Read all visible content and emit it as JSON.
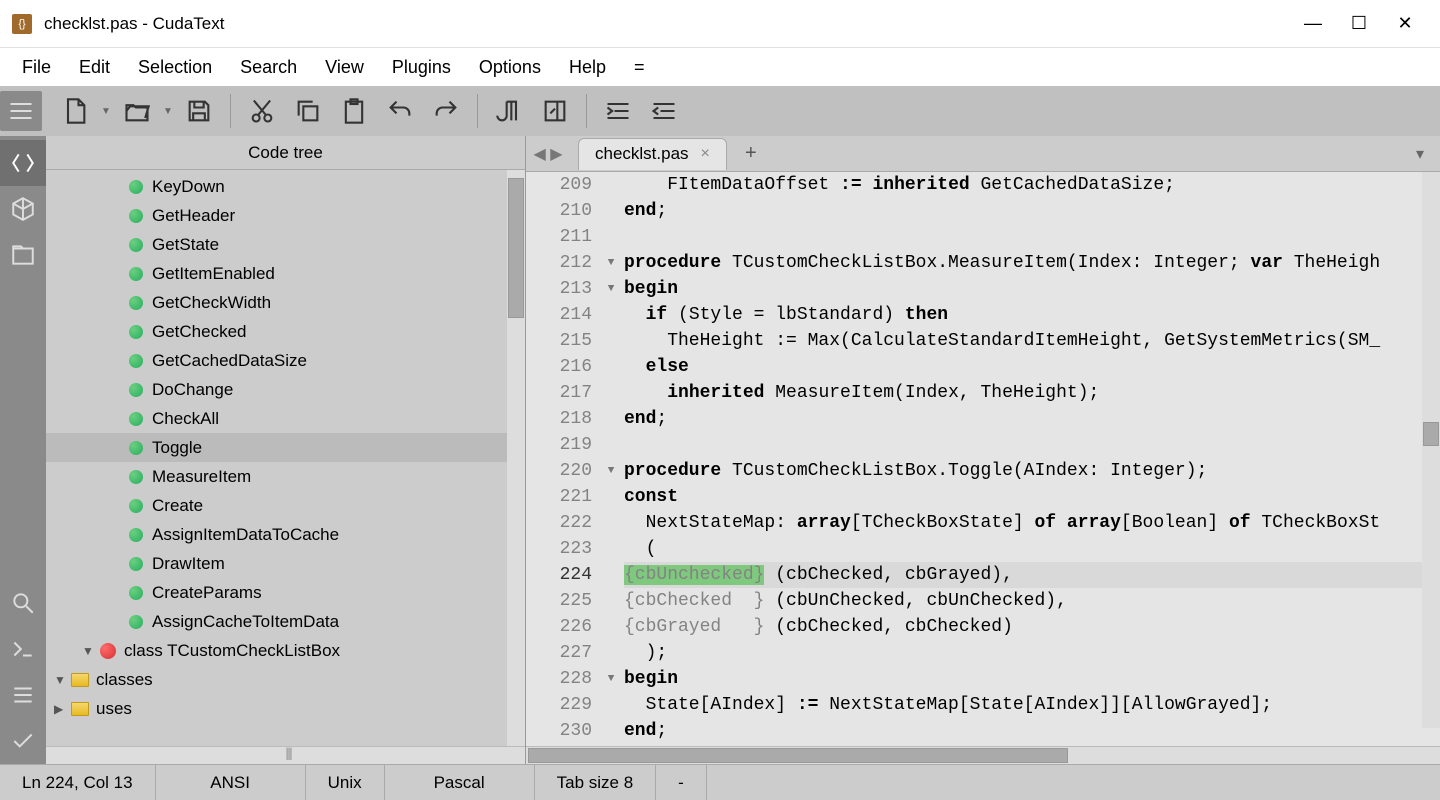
{
  "window": {
    "title": "checklst.pas - CudaText"
  },
  "menu": [
    "File",
    "Edit",
    "Selection",
    "Search",
    "View",
    "Plugins",
    "Options",
    "Help",
    "="
  ],
  "sidepanel": {
    "title": "Code tree"
  },
  "tree": [
    {
      "depth": 0,
      "type": "folder",
      "expand": "▶",
      "label": "uses"
    },
    {
      "depth": 0,
      "type": "folder",
      "expand": "▼",
      "label": "classes"
    },
    {
      "depth": 1,
      "type": "class",
      "expand": "▼",
      "label": "class TCustomCheckListBox"
    },
    {
      "depth": 2,
      "type": "method",
      "label": "AssignCacheToItemData"
    },
    {
      "depth": 2,
      "type": "method",
      "label": "CreateParams"
    },
    {
      "depth": 2,
      "type": "method",
      "label": "DrawItem"
    },
    {
      "depth": 2,
      "type": "method",
      "label": "AssignItemDataToCache"
    },
    {
      "depth": 2,
      "type": "method",
      "label": "Create"
    },
    {
      "depth": 2,
      "type": "method",
      "label": "MeasureItem"
    },
    {
      "depth": 2,
      "type": "method",
      "label": "Toggle",
      "selected": true
    },
    {
      "depth": 2,
      "type": "method",
      "label": "CheckAll"
    },
    {
      "depth": 2,
      "type": "method",
      "label": "DoChange"
    },
    {
      "depth": 2,
      "type": "method",
      "label": "GetCachedDataSize"
    },
    {
      "depth": 2,
      "type": "method",
      "label": "GetChecked"
    },
    {
      "depth": 2,
      "type": "method",
      "label": "GetCheckWidth"
    },
    {
      "depth": 2,
      "type": "method",
      "label": "GetItemEnabled"
    },
    {
      "depth": 2,
      "type": "method",
      "label": "GetState"
    },
    {
      "depth": 2,
      "type": "method",
      "label": "GetHeader"
    },
    {
      "depth": 2,
      "type": "method",
      "label": "KeyDown"
    }
  ],
  "tab": {
    "name": "checklst.pas"
  },
  "code": {
    "startLine": 209,
    "lines": [
      {
        "n": 209,
        "html": "    FItemDataOffset <span class='kw'>:=</span> <span class='kw'>inherited</span> GetCachedDataSize;"
      },
      {
        "n": 210,
        "html": "<span class='kw'>end</span>;"
      },
      {
        "n": 211,
        "html": ""
      },
      {
        "n": 212,
        "fold": "▼",
        "html": "<span class='kw'>procedure</span> TCustomCheckListBox.MeasureItem(Index: Integer; <span class='kw'>var</span> TheHeigh"
      },
      {
        "n": 213,
        "fold": "▼",
        "html": "<span class='kw'>begin</span>"
      },
      {
        "n": 214,
        "html": "  <span class='kw'>if</span> (Style = lbStandard) <span class='kw'>then</span>"
      },
      {
        "n": 215,
        "html": "    TheHeight := Max(CalculateStandardItemHeight, GetSystemMetrics(SM_"
      },
      {
        "n": 216,
        "html": "  <span class='kw'>else</span>"
      },
      {
        "n": 217,
        "html": "    <span class='kw'>inherited</span> MeasureItem(Index, TheHeight);"
      },
      {
        "n": 218,
        "html": "<span class='kw'>end</span>;"
      },
      {
        "n": 219,
        "html": ""
      },
      {
        "n": 220,
        "fold": "▼",
        "html": "<span class='kw'>procedure</span> TCustomCheckListBox.Toggle(AIndex: Integer);"
      },
      {
        "n": 221,
        "html": "<span class='kw'>const</span>"
      },
      {
        "n": 222,
        "html": "  NextStateMap: <span class='kw'>array</span>[TCheckBoxState] <span class='kw'>of</span> <span class='kw'>array</span>[Boolean] <span class='kw'>of</span> TCheckBoxSt"
      },
      {
        "n": 223,
        "html": "  ("
      },
      {
        "n": 224,
        "current": true,
        "html": "<span class='hl'><span class='cmt'>{cbUnchecked}</span></span> (cbChecked, cbGrayed),"
      },
      {
        "n": 225,
        "html": "<span class='cmt'>{cbChecked  }</span> (cbUnChecked, cbUnChecked),"
      },
      {
        "n": 226,
        "html": "<span class='cmt'>{cbGrayed   }</span> (cbChecked, cbChecked)"
      },
      {
        "n": 227,
        "html": "  );"
      },
      {
        "n": 228,
        "fold": "▼",
        "html": "<span class='kw'>begin</span>"
      },
      {
        "n": 229,
        "html": "  State[AIndex] <span class='kw'>:=</span> NextStateMap[State[AIndex]][AllowGrayed];"
      },
      {
        "n": 230,
        "html": "<span class='kw'>end</span>;"
      }
    ]
  },
  "status": {
    "pos": "Ln 224, Col 13",
    "encoding": "ANSI",
    "lineend": "Unix",
    "lexer": "Pascal",
    "tabsize": "Tab size 8",
    "mode": "-"
  }
}
